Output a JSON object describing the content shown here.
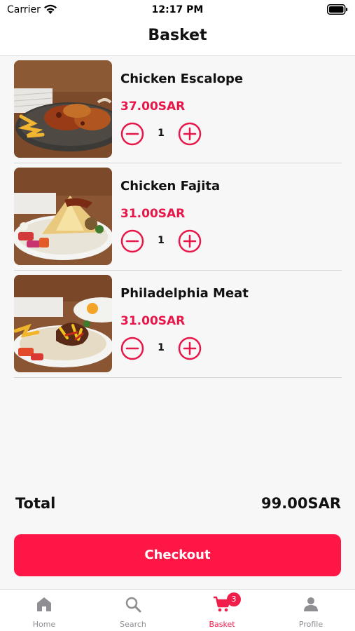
{
  "status_bar": {
    "carrier": "Carrier",
    "time": "12:17 PM"
  },
  "header": {
    "title": "Basket"
  },
  "items": [
    {
      "name": "Chicken Escalope",
      "price": "37.00SAR",
      "quantity": "1"
    },
    {
      "name": "Chicken Fajita",
      "price": "31.00SAR",
      "quantity": "1"
    },
    {
      "name": "Philadelphia Meat",
      "price": "31.00SAR",
      "quantity": "1"
    }
  ],
  "summary": {
    "total_label": "Total",
    "total_value": "99.00SAR"
  },
  "checkout_label": "Checkout",
  "tabs": [
    {
      "label": "Home",
      "icon": "home-icon"
    },
    {
      "label": "Search",
      "icon": "search-icon"
    },
    {
      "label": "Basket",
      "icon": "cart-icon",
      "badge": "3",
      "active": true
    },
    {
      "label": "Profile",
      "icon": "person-icon"
    }
  ],
  "colors": {
    "accent": "#fe1746",
    "price": "#e8174a",
    "inactive_tab": "#8e8e93"
  }
}
